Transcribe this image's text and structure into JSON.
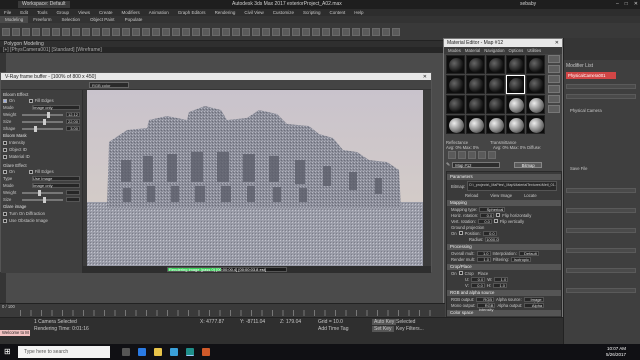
{
  "window": {
    "app_title": "Autodesk 3ds Max 2017    exteriorProject_A02.max",
    "workspace": "Workspace: Default",
    "user": "sebaby"
  },
  "menubar": [
    "File",
    "Edit",
    "Tools",
    "Group",
    "Views",
    "Create",
    "Modifiers",
    "Animation",
    "Graph Editors",
    "Rendering",
    "Civil View",
    "Customize",
    "Scripting",
    "Content",
    "Help"
  ],
  "ribbon_tabs": [
    "Modeling",
    "Freeform",
    "Selection",
    "Object Paint",
    "Populate"
  ],
  "ribbon_sub": "Polygon Modeling",
  "viewport_label": "[+] [PhysCamera001] [Standard] [Wireframe]",
  "frame_buffer": {
    "title": "V-Ray frame buffer - [100% of 800 x 450]",
    "channel": "RGB color",
    "bloom_title": "Bloom Effect",
    "glare_title": "Glare Effect",
    "rows": [
      {
        "label": "On",
        "kind": "check",
        "on": true,
        "extra": "Fill Edges"
      },
      {
        "label": "Mode",
        "kind": "select",
        "value": "Image only"
      },
      {
        "label": "Weight",
        "kind": "slider",
        "value": "12.12",
        "level": 0.6
      },
      {
        "label": "Size",
        "kind": "slider",
        "value": "22.00",
        "level": 0.5
      },
      {
        "label": "Shape",
        "kind": "slider",
        "value": "3.00",
        "level": 0.3
      },
      {
        "label": "Bloom Mask",
        "kind": "header"
      },
      {
        "label": "Intensity",
        "kind": "check",
        "on": false
      },
      {
        "label": "Object ID",
        "kind": "check",
        "on": false
      },
      {
        "label": "Material ID",
        "kind": "check",
        "on": false
      }
    ],
    "glare_rows": [
      {
        "label": "On",
        "kind": "check",
        "on": false,
        "extra": "Fill Edges"
      },
      {
        "label": "Type",
        "kind": "select",
        "value": "Use Image"
      },
      {
        "label": "Mode",
        "kind": "select",
        "value": "Image only"
      },
      {
        "label": "Weight",
        "kind": "slider",
        "value": "",
        "level": 0.4
      },
      {
        "label": "Size",
        "kind": "slider",
        "value": "",
        "level": 0.5
      },
      {
        "label": "Glare image",
        "kind": "header"
      },
      {
        "label": "Turn On Diffraction",
        "kind": "check",
        "on": false
      },
      {
        "label": "Use Obstacle Image",
        "kind": "check",
        "on": false
      }
    ],
    "status": "Rendering image (pass 0) [00:00:00.4] [00:00:03.8 est]",
    "progress": 0.45
  },
  "material_editor": {
    "title": "Material Editor - Map #12",
    "menu": [
      "Modes",
      "Material",
      "Navigation",
      "Options",
      "Utilities"
    ],
    "reflectance": "Reflectance",
    "reflectance_vals": "Avg: 0%  Max: 0%",
    "transmittance": "Transmittance",
    "transmittance_vals": "Avg: 0%  Max: 0%   Diffuse:",
    "map_name": "Map #12",
    "map_type": "Bitmap",
    "rollouts": {
      "params": "Parameters",
      "bitmap_label": "Bitmap:",
      "bitmap_path": "D:\\_projects\\_MaPies\\_Map\\MaterialTextures\\Metl_01...",
      "reload": "Reload",
      "view_image": "View Image",
      "locate": "Locate",
      "mapping": "Mapping",
      "mapping_type": "Spherical",
      "horiz": "Horiz. rotation:",
      "horiz_val": "0.0",
      "vert": "Vert. rotation:",
      "vert_val": "0.0",
      "flip_h": "Flip horizontally",
      "flip_v": "Flip vertically",
      "ground": "Ground projection",
      "gp_on": "On",
      "position": "Position:",
      "position_val": "0.0",
      "radius": "Radius:",
      "radius_val": "1000.0",
      "processing": "Processing",
      "overall": "Overall mult:",
      "overall_val": "1.0",
      "render_mult": "Render mult:",
      "render_val": "1.0",
      "interpolation": "Interpolation:",
      "interp_val": "Default",
      "filtering": "Filtering:",
      "filter_val": "Isotropic",
      "crop": "Crop/Place",
      "crop_on": "On",
      "crop_mode": "Crop",
      "place_mode": "Place",
      "u": "U:",
      "v": "V:",
      "w": "W:",
      "h": "H:",
      "uv_val": "0.0",
      "wh_val": "1.0",
      "rgb_alpha": "RGB and alpha source",
      "rgb_output": "RGB output:",
      "rgb_output_val": "RGB color",
      "alpha_source": "Alpha source:",
      "alpha_source_val": "Image alpha",
      "mono_output": "Mono output:",
      "mono_output_val": "RGB intensity",
      "alpha_output": "Alpha output:",
      "alpha_output_val": "Alpha",
      "color_space": "Color space",
      "cs_type": "Type:",
      "cs_type_val": "Inv. gamma",
      "inverse_gamma": "Inverse gamma:",
      "inverse_gamma_val": "1.0",
      "preview": "UDIM/UVTILE preview in material editor"
    }
  },
  "command_panel": {
    "modifier_list": "Modifier List",
    "selected": "PhysicalCamera001",
    "items": [
      "Physical Camera",
      "Save File",
      "",
      ""
    ]
  },
  "timeline": {
    "frame": "0 / 100",
    "ticks": [
      "0",
      "10",
      "20",
      "30",
      "40",
      "50",
      "60",
      "70",
      "80",
      "90",
      "100"
    ]
  },
  "status": {
    "selection": "1 Camera Selected",
    "render_time": "Rendering Time: 0:01:16",
    "maxscript": "Welcome to M",
    "x": "X: 4777.87",
    "y": "Y: -8711.04",
    "z": "Z: 179.04",
    "grid": "Grid = 10.0",
    "add_time_tag": "Add Time Tag",
    "auto_key": "Auto Key",
    "selected": "Selected",
    "set_key": "Set Key",
    "key_filters": "Key Filters..."
  },
  "taskbar": {
    "search": "Type here to search",
    "time": "10:07 AM",
    "date": "5/26/2017"
  },
  "colors": {
    "accent": "#d14646",
    "progress": "#3ad05a"
  }
}
